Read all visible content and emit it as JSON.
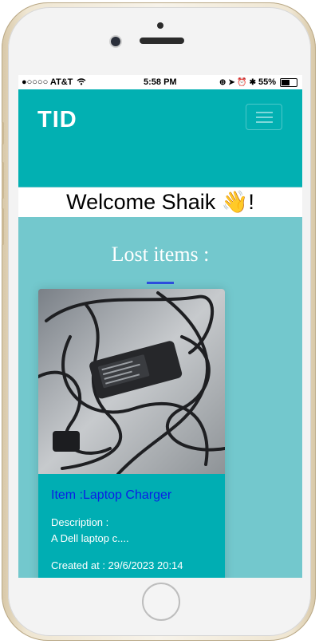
{
  "status": {
    "carrier": "●○○○○ AT&T",
    "time": "5:58 PM",
    "battery": "55%"
  },
  "navbar": {
    "brand": "TID"
  },
  "welcome": "Welcome Shaik 👋!",
  "section": {
    "title": "Lost items :"
  },
  "items": [
    {
      "title": "Item :Laptop Charger",
      "description_label": "Description :",
      "description": "A Dell laptop c....",
      "created": "Created at : 29/6/2023 20:14"
    }
  ],
  "colors": {
    "navbar": "#02b0b2",
    "page": "#73c8cd",
    "card": "#00aeb3",
    "title_link": "#0a1ee6",
    "accent_line": "#2d4fe0"
  },
  "icons": [
    "wifi-icon",
    "hamburger-menu-icon",
    "battery-icon"
  ]
}
